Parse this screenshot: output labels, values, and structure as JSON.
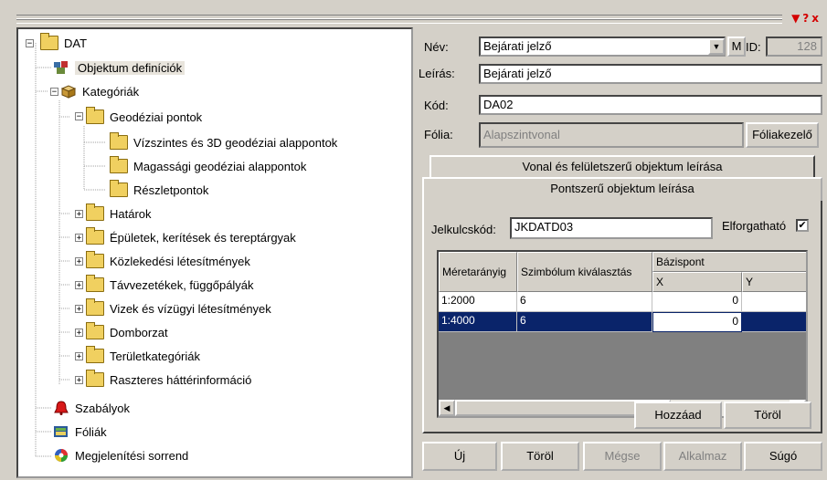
{
  "window": {
    "title_icons": "▼?x"
  },
  "tree": {
    "root": "DAT",
    "objects": "Objektum definíciók",
    "categories": "Kategóriák",
    "geodetic": "Geodéziai pontok",
    "horizontal": "Vízszintes és 3D geodéziai alappontok",
    "height": "Magassági geodéziai alappontok",
    "detail": "Részletpontok",
    "boundaries": "Határok",
    "buildings": "Épületek, kerítések és tereptárgyak",
    "utilities": "Közlekedési létesítmények",
    "lines": "Távvezetékek, függőpályák",
    "water": "Vizek és vízügyi létesítmények",
    "relief": "Domborzat",
    "landcat": "Területkategóriák",
    "raster": "Raszteres háttérinformáció",
    "rules": "Szabályok",
    "layers": "Fóliák",
    "order": "Megjelenítési sorrend"
  },
  "form": {
    "name_label": "Név:",
    "name_value": "Bejárati jelző",
    "m_button": "M",
    "id_label": "ID:",
    "id_value": "128",
    "desc_label": "Leírás:",
    "desc_value": "Bejárati jelző",
    "code_label": "Kód:",
    "code_value": "DA02",
    "layer_label": "Fólia:",
    "layer_value": "Alapszintvonal",
    "layer_button": "Fóliakezelő"
  },
  "tabs": {
    "line_tab": "Vonal és felületszerű objektum leírása",
    "point_tab": "Pontszerű objektum leírása"
  },
  "point": {
    "symbol_label": "Jelkulcskód:",
    "symbol_value": "JKDATD03",
    "rotatable_label": "Elforgatható",
    "rotatable_checked": "✔"
  },
  "grid": {
    "headers": {
      "scale": "Méretarányig",
      "symbol": "Szimbólum kiválasztás",
      "base": "Bázispont",
      "x": "X",
      "y": "Y"
    },
    "rows": [
      {
        "scale": "1:2000",
        "symbol": "6",
        "x": "0"
      },
      {
        "scale": "1:4000",
        "symbol": "6",
        "x": "0"
      }
    ],
    "add_button": "Hozzáad",
    "remove_button": "Töröl"
  },
  "footer": {
    "new": "Új",
    "delete": "Töröl",
    "cancel": "Mégse",
    "apply": "Alkalmaz",
    "help": "Súgó"
  },
  "colors": {
    "selection": "#0a246a",
    "title_icons": "#d40000"
  }
}
